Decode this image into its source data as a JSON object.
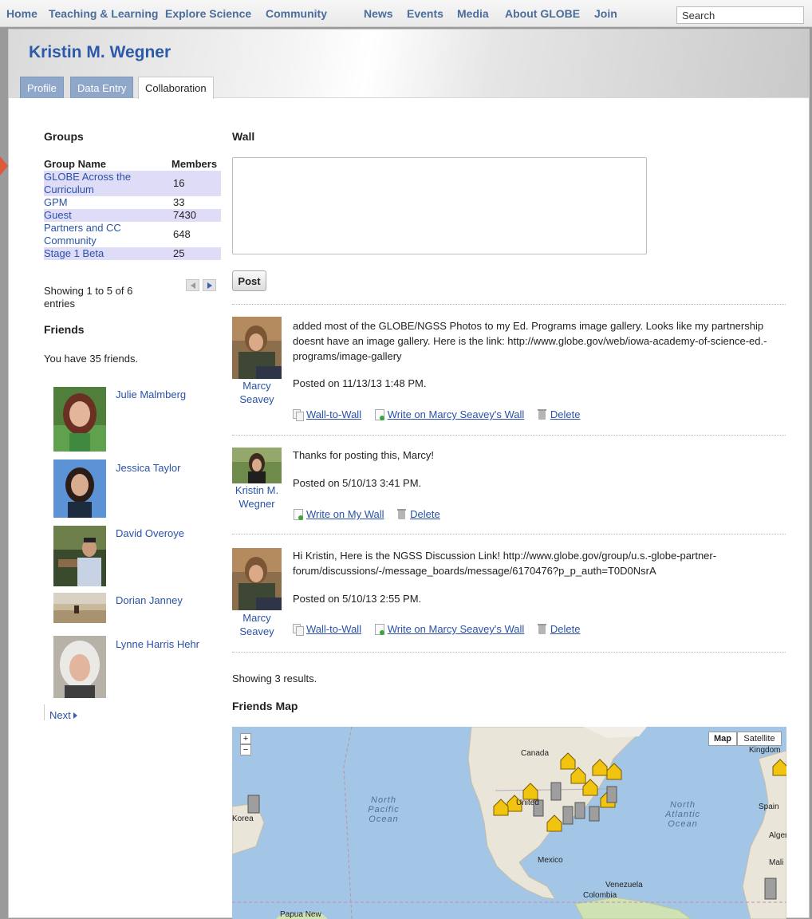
{
  "topnav": {
    "items": [
      "Home",
      "Teaching & Learning",
      "Explore Science",
      "Community",
      "News",
      "Events",
      "Media",
      "About GLOBE",
      "Join"
    ],
    "search_value": "Search"
  },
  "profile": {
    "name": "Kristin M. Wegner",
    "tabs": [
      "Profile",
      "Data Entry",
      "Collaboration"
    ],
    "active_tab": "Collaboration"
  },
  "groups": {
    "heading": "Groups",
    "col_name": "Group Name",
    "col_members": "Members",
    "rows": [
      {
        "name": "GLOBE Across the Curriculum",
        "members": "16"
      },
      {
        "name": "GPM",
        "members": "33"
      },
      {
        "name": "Guest",
        "members": "7430"
      },
      {
        "name": "Partners and CC Community",
        "members": "648"
      },
      {
        "name": "Stage 1 Beta",
        "members": "25"
      }
    ],
    "showing": "Showing 1 to 5 of 6 entries"
  },
  "friends": {
    "heading": "Friends",
    "count_text": "You have 35 friends.",
    "list": [
      {
        "name": "Julie Malmberg"
      },
      {
        "name": "Jessica Taylor"
      },
      {
        "name": "David Overoye"
      },
      {
        "name": "Dorian Janney"
      },
      {
        "name": "Lynne Harris Hehr"
      }
    ],
    "next_label": "Next"
  },
  "wall": {
    "heading": "Wall",
    "textarea_value": "",
    "post_label": "Post",
    "posts": [
      {
        "author": "Marcy Seavey",
        "text": "added most of the GLOBE/NGSS Photos to my Ed. Programs image gallery. Looks like my partnership doesnt have an image gallery. Here is the link: http://www.globe.gov/web/iowa-academy-of-science-ed.-programs/image-gallery",
        "date": "Posted on 11/13/13 1:48 PM.",
        "actions": [
          "Wall-to-Wall",
          "Write on Marcy Seavey's Wall",
          "Delete"
        ]
      },
      {
        "author": "Kristin M. Wegner",
        "text": "Thanks for posting this, Marcy!",
        "date": "Posted on 5/10/13 3:41 PM.",
        "actions": [
          "Write on My Wall",
          "Delete"
        ]
      },
      {
        "author": "Marcy Seavey",
        "text": "Hi Kristin, Here is the NGSS Discussion Link! http://www.globe.gov/group/u.s.-globe-partner-forum/discussions/-/message_boards/message/6170476?p_p_auth=T0D0NsrA",
        "date": "Posted on 5/10/13 2:55 PM.",
        "actions": [
          "Wall-to-Wall",
          "Write on Marcy Seavey's Wall",
          "Delete"
        ]
      }
    ],
    "showing_results": "Showing 3 results."
  },
  "friends_map": {
    "heading": "Friends Map",
    "map_type_buttons": [
      "Map",
      "Satellite"
    ],
    "zoom_in": "+",
    "zoom_out": "−",
    "labels": {
      "canada": "Canada",
      "united": "United",
      "mexico": "Mexico",
      "venezuela": "Venezuela",
      "colombia": "Colombia",
      "korea": "Korea",
      "papua": "Papua New",
      "kingdom": "Kingdom",
      "spain": "Spain",
      "alger": "Alger",
      "mali": "Mali",
      "north_pacific": "North Pacific Ocean",
      "north_atlantic": "North Atlantic Ocean"
    }
  }
}
